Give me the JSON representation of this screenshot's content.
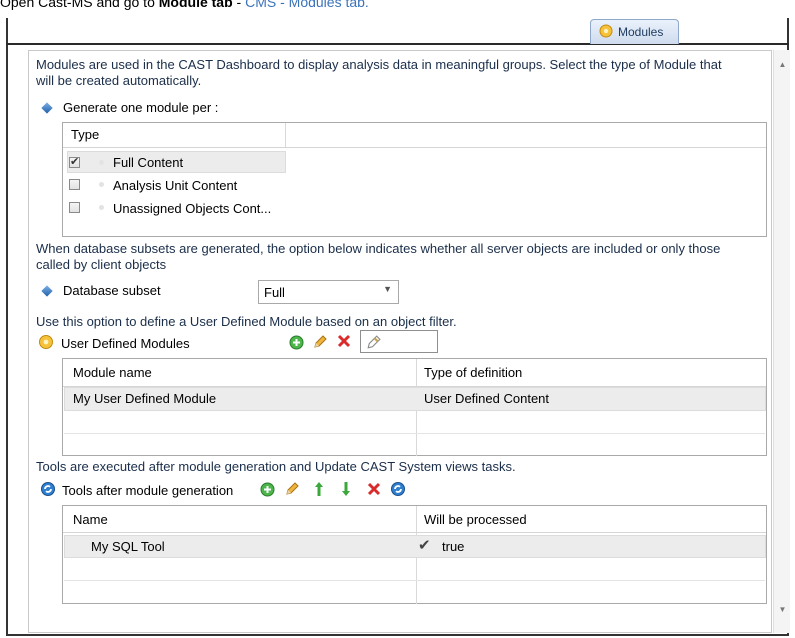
{
  "caption": {
    "prefix": "Open Cast-MS and go to",
    "bold": "Module tab",
    "separator": " - ",
    "link": "CMS - Modules tab."
  },
  "tab": {
    "label": "Modules"
  },
  "intro": {
    "line1": "Modules are used in the CAST Dashboard to display analysis data in meaningful groups. Select the type of Module that",
    "line2": "will be created automatically."
  },
  "generate": {
    "label": "Generate one module per :",
    "header": "Type",
    "items": [
      {
        "label": "Full Content",
        "checked": true
      },
      {
        "label": "Analysis Unit Content",
        "checked": false
      },
      {
        "label": "Unassigned Objects Cont...",
        "checked": false
      }
    ]
  },
  "db_subset": {
    "desc_line1": "When database subsets are generated, the option below indicates whether all server objects are included or only those",
    "desc_line2": "called by client objects",
    "label": "Database subset",
    "value": "Full"
  },
  "udm": {
    "desc": "Use this option to define a User Defined Module based on an object filter.",
    "label": "User Defined Modules",
    "columns": [
      "Module name",
      "Type of definition"
    ],
    "rows": [
      {
        "name": "My User Defined Module",
        "type": "User Defined Content"
      }
    ]
  },
  "tools": {
    "desc": "Tools are executed after module generation and Update CAST System views tasks.",
    "label": "Tools after module generation",
    "columns": [
      "Name",
      "Will be processed"
    ],
    "rows": [
      {
        "name": "My SQL Tool",
        "processed": "true"
      }
    ]
  },
  "colors": {
    "accent": "#1d3f73",
    "link": "#3b73b9",
    "add": "#3aa83a",
    "delete": "#d92b2b"
  }
}
